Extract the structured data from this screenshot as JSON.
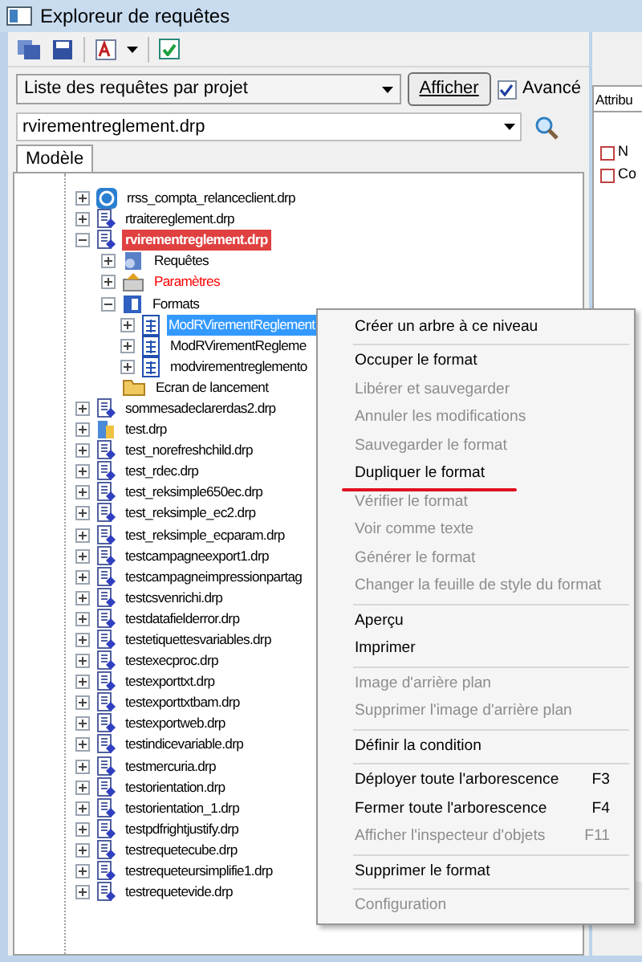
{
  "window": {
    "title": "Exploreur de requêtes"
  },
  "toolbar": {
    "advanced_checked": true
  },
  "query_list": {
    "value": "Liste des requêtes par projet",
    "button": "Afficher",
    "advanced": {
      "label": "Avancé",
      "checked": true
    }
  },
  "search": {
    "value": "rvirementreglement.drp"
  },
  "tabs": [
    {
      "label": "Modèle",
      "selected": true
    }
  ],
  "right_panel": {
    "tab": "Attribu",
    "rows": [
      "N",
      "Co"
    ]
  },
  "tree": [
    {
      "label": "rrss_compta_relanceclient.drp",
      "kind": "app",
      "expanded": false,
      "selected": false,
      "highlighted": false
    },
    {
      "label": "rtraitereglement.drp",
      "kind": "project",
      "expanded": false,
      "selected": false,
      "highlighted": false
    },
    {
      "label": "rvirementreglement.drp",
      "kind": "project",
      "expanded": true,
      "selected": false,
      "highlighted": true,
      "children": [
        {
          "label": "Requêtes",
          "kind": "queries",
          "expanded": false,
          "selected": false,
          "highlighted": false
        },
        {
          "label": "Paramètres",
          "kind": "params",
          "expanded": false,
          "selected": false,
          "highlighted": false,
          "color": "#ff0000"
        },
        {
          "label": "Formats",
          "kind": "formats",
          "expanded": true,
          "selected": false,
          "highlighted": false,
          "children": [
            {
              "label": "ModRVirementReglement",
              "kind": "format",
              "expanded": false,
              "selected": true,
              "highlighted": false
            },
            {
              "label": "ModRVirementRegleme",
              "kind": "format",
              "expanded": false,
              "selected": false,
              "highlighted": false
            },
            {
              "label": "modvirementreglemento",
              "kind": "format",
              "expanded": false,
              "selected": false,
              "highlighted": false
            }
          ]
        },
        {
          "label": "Ecran de lancement",
          "kind": "folder",
          "selected": false,
          "highlighted": false
        }
      ]
    },
    {
      "label": "sommesadeclarerdas2.drp",
      "kind": "project",
      "expanded": false,
      "selected": false,
      "highlighted": false
    },
    {
      "label": "test.drp",
      "kind": "db",
      "expanded": false,
      "selected": false,
      "highlighted": false
    },
    {
      "label": "test_norefreshchild.drp",
      "kind": "project",
      "expanded": false,
      "selected": false,
      "highlighted": false
    },
    {
      "label": "test_rdec.drp",
      "kind": "project",
      "expanded": false,
      "selected": false,
      "highlighted": false
    },
    {
      "label": "test_reksimple650ec.drp",
      "kind": "project",
      "expanded": false,
      "selected": false,
      "highlighted": false
    },
    {
      "label": "test_reksimple_ec2.drp",
      "kind": "project",
      "expanded": false,
      "selected": false,
      "highlighted": false
    },
    {
      "label": "test_reksimple_ecparam.drp",
      "kind": "project",
      "expanded": false,
      "selected": false,
      "highlighted": false
    },
    {
      "label": "testcampagneexport1.drp",
      "kind": "project",
      "expanded": false,
      "selected": false,
      "highlighted": false
    },
    {
      "label": "testcampagneimpressionpartag",
      "kind": "project",
      "expanded": false,
      "selected": false,
      "highlighted": false
    },
    {
      "label": "testcsvenrichi.drp",
      "kind": "project",
      "expanded": false,
      "selected": false,
      "highlighted": false
    },
    {
      "label": "testdatafielderror.drp",
      "kind": "project",
      "expanded": false,
      "selected": false,
      "highlighted": false
    },
    {
      "label": "testetiquettesvariables.drp",
      "kind": "project",
      "expanded": false,
      "selected": false,
      "highlighted": false
    },
    {
      "label": "testexecproc.drp",
      "kind": "project",
      "expanded": false,
      "selected": false,
      "highlighted": false
    },
    {
      "label": "testexporttxt.drp",
      "kind": "project",
      "expanded": false,
      "selected": false,
      "highlighted": false
    },
    {
      "label": "testexporttxtbam.drp",
      "kind": "project",
      "expanded": false,
      "selected": false,
      "highlighted": false
    },
    {
      "label": "testexportweb.drp",
      "kind": "project",
      "expanded": false,
      "selected": false,
      "highlighted": false
    },
    {
      "label": "testindicevariable.drp",
      "kind": "project",
      "expanded": false,
      "selected": false,
      "highlighted": false
    },
    {
      "label": "testmercuria.drp",
      "kind": "project",
      "expanded": false,
      "selected": false,
      "highlighted": false
    },
    {
      "label": "testorientation.drp",
      "kind": "project",
      "expanded": false,
      "selected": false,
      "highlighted": false
    },
    {
      "label": "testorientation_1.drp",
      "kind": "project",
      "expanded": false,
      "selected": false,
      "highlighted": false
    },
    {
      "label": "testpdfrightjustify.drp",
      "kind": "project",
      "expanded": false,
      "selected": false,
      "highlighted": false
    },
    {
      "label": "testrequetecube.drp",
      "kind": "project",
      "expanded": false,
      "selected": false,
      "highlighted": false
    },
    {
      "label": "testrequeteursimplifie1.drp",
      "kind": "project",
      "expanded": false,
      "selected": false,
      "highlighted": false
    },
    {
      "label": "testrequetevide.drp",
      "kind": "project",
      "expanded": false,
      "selected": false,
      "highlighted": false
    }
  ],
  "context_menu": [
    {
      "kind": "item",
      "label": "Créer un arbre à ce niveau",
      "disabled": false
    },
    {
      "kind": "separator"
    },
    {
      "kind": "item",
      "label": "Occuper le format",
      "disabled": false
    },
    {
      "kind": "item",
      "label": "Libérer et sauvegarder",
      "disabled": true
    },
    {
      "kind": "item",
      "label": "Annuler les modifications",
      "disabled": true
    },
    {
      "kind": "item",
      "label": "Sauvegarder le format",
      "disabled": true
    },
    {
      "kind": "item",
      "label": "Dupliquer le format",
      "disabled": false,
      "marked": true
    },
    {
      "kind": "item",
      "label": "Vérifier le format",
      "disabled": true
    },
    {
      "kind": "item",
      "label": "Voir comme texte",
      "disabled": true
    },
    {
      "kind": "item",
      "label": "Générer le format",
      "disabled": true
    },
    {
      "kind": "item",
      "label": "Changer la feuille de style du format",
      "disabled": true
    },
    {
      "kind": "separator"
    },
    {
      "kind": "item",
      "label": "Aperçu",
      "disabled": false
    },
    {
      "kind": "item",
      "label": "Imprimer",
      "disabled": false
    },
    {
      "kind": "separator"
    },
    {
      "kind": "item",
      "label": "Image d'arrière plan",
      "disabled": true
    },
    {
      "kind": "item",
      "label": "Supprimer l'image d'arrière plan",
      "disabled": true
    },
    {
      "kind": "separator"
    },
    {
      "kind": "item",
      "label": "Définir la condition",
      "disabled": false
    },
    {
      "kind": "separator"
    },
    {
      "kind": "item",
      "label": "Déployer toute l'arborescence",
      "shortcut": "F3",
      "disabled": false
    },
    {
      "kind": "item",
      "label": "Fermer toute l'arborescence",
      "shortcut": "F4",
      "disabled": false
    },
    {
      "kind": "item",
      "label": "Afficher l'inspecteur d'objets",
      "shortcut": "F11",
      "disabled": true
    },
    {
      "kind": "separator"
    },
    {
      "kind": "item",
      "label": "Supprimer le format",
      "disabled": false
    },
    {
      "kind": "separator"
    },
    {
      "kind": "item",
      "label": "Configuration",
      "disabled": true
    }
  ]
}
